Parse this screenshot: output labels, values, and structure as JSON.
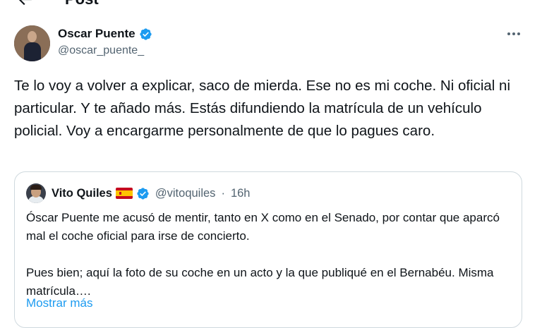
{
  "header": {
    "title": "Post"
  },
  "tweet": {
    "author_name": "Oscar Puente",
    "author_handle": "@oscar_puente_",
    "text": "Te lo voy a volver a explicar, saco de mierda. Ese no es mi coche. Ni oficial ni particular. Y te añado más. Estás difundiendo la matrícula de un vehículo policial. Voy a encargarme personalmente de que lo pagues caro."
  },
  "quote": {
    "author_name": "Vito Quiles",
    "flag_icon": "spain-flag-icon",
    "author_handle": "@vitoquiles",
    "time": "16h",
    "text": "Óscar Puente me acusó de mentir, tanto en X como en el Senado, por contar que aparcó mal el coche oficial para irse de concierto.\n\nPues bien; aquí la foto de su coche en un acto y la que publiqué en el Bernabéu. Misma matrícula….",
    "show_more": "Mostrar más"
  },
  "colors": {
    "verified": "#1d9bf0",
    "muted": "#536471",
    "link": "#1d9bf0",
    "border": "#cfd9de"
  }
}
